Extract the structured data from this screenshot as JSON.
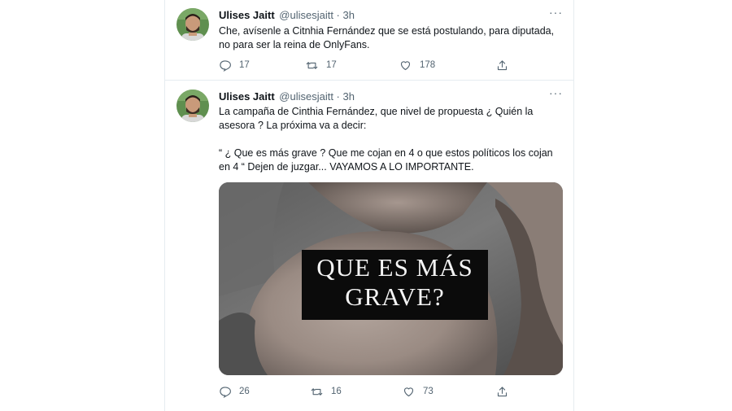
{
  "tweets": [
    {
      "author_name": "Ulises Jaitt",
      "author_handle": "@ulisesjaitt · 3h",
      "text_lines": [
        "Che, avísenle a Citnhia Fernández que se está postulando, para diputada,\nno para ser la reina de OnlyFans."
      ],
      "replies": "17",
      "retweets": "17",
      "likes": "178"
    },
    {
      "author_name": "Ulises Jaitt",
      "author_handle": "@ulisesjaitt · 3h",
      "paragraph1": "La campaña de Cinthia Fernández, que nivel de propuesta ¿ Quién la\nasesora ? La próxima va a decir:",
      "paragraph2": "“ ¿ Que es más grave ? Que me cojan en 4 o que estos políticos los cojan\nen 4 “  Dejen de juzgar... VAYAMOS A LO IMPORTANTE.",
      "media_overlay_line1": "QUE ES MÁS",
      "media_overlay_line2": "GRAVE?",
      "replies": "26",
      "retweets": "16",
      "likes": "73"
    }
  ],
  "icons": {
    "more": "more-icon",
    "reply": "reply-icon",
    "retweet": "retweet-icon",
    "like": "heart-icon",
    "share": "share-icon"
  },
  "colors": {
    "text": "#0f1419",
    "secondary": "#536471",
    "border": "#e6ecf0"
  }
}
